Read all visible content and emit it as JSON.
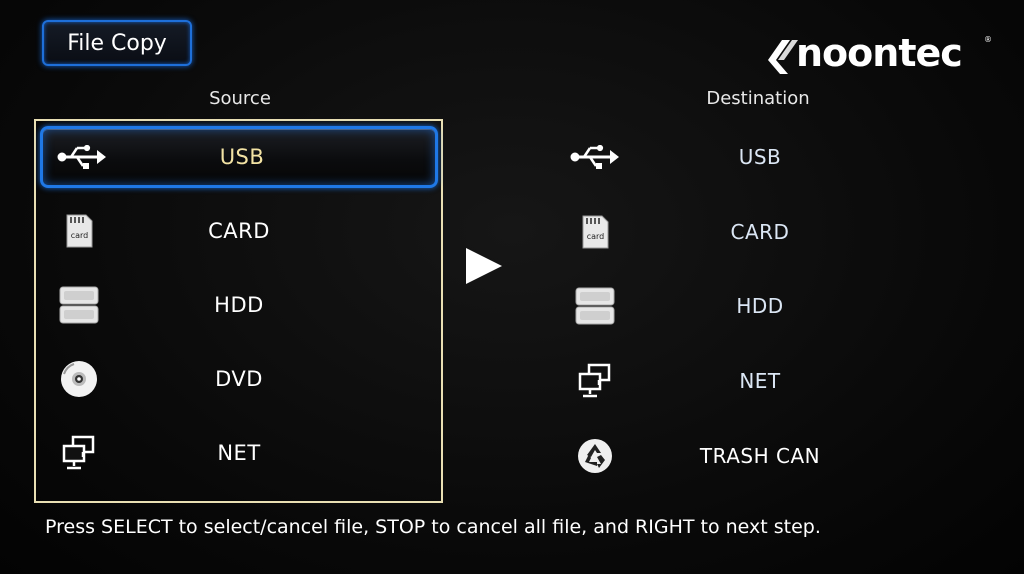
{
  "header": {
    "title": "File Copy",
    "brand": "noontec"
  },
  "source": {
    "heading": "Source",
    "selected_index": 0,
    "items": [
      {
        "label": "USB",
        "icon": "usb-icon"
      },
      {
        "label": "CARD",
        "icon": "sd-card-icon"
      },
      {
        "label": "HDD",
        "icon": "hdd-icon"
      },
      {
        "label": "DVD",
        "icon": "dvd-icon"
      },
      {
        "label": "NET",
        "icon": "network-icon"
      }
    ]
  },
  "destination": {
    "heading": "Destination",
    "items": [
      {
        "label": "USB",
        "icon": "usb-icon"
      },
      {
        "label": "CARD",
        "icon": "sd-card-icon"
      },
      {
        "label": "HDD",
        "icon": "hdd-icon"
      },
      {
        "label": "NET",
        "icon": "network-icon"
      },
      {
        "label": "TRASH CAN",
        "icon": "recycle-icon"
      }
    ]
  },
  "footer": {
    "hint": "Press SELECT to select/cancel file, STOP to cancel all file, and RIGHT to next step."
  },
  "colors": {
    "selection_border": "#1f78e6",
    "panel_border": "#e9dfb3",
    "selected_text": "#f3e3a4"
  }
}
